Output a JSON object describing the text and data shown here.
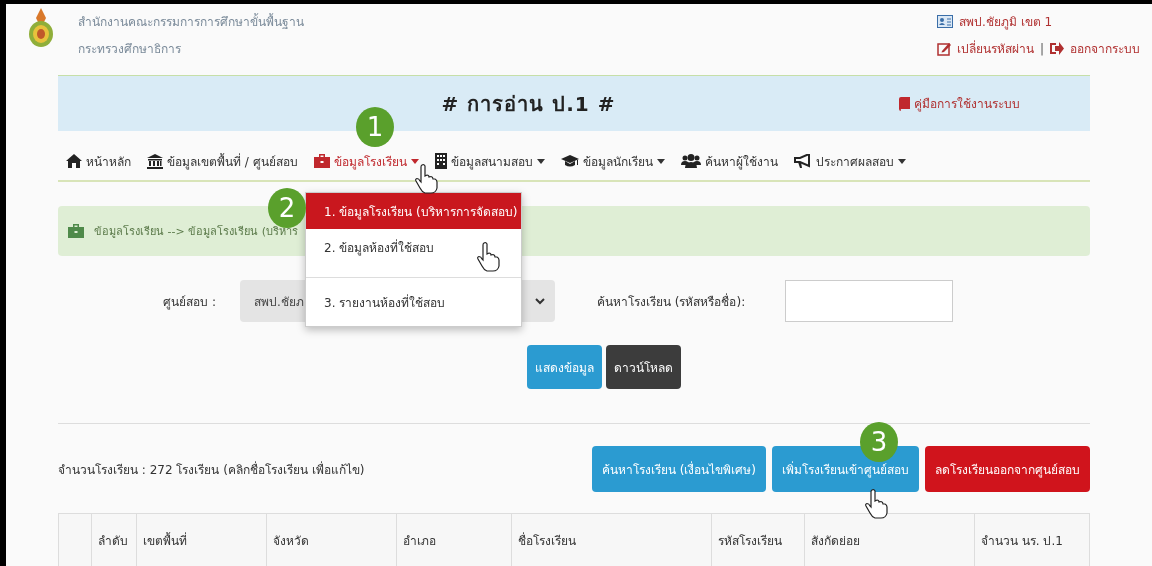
{
  "header": {
    "org_lines": [
      "สำนักงานคณะกรรมการการศึกษาขั้นพื้นฐาน",
      "กระทรวงศึกษาธิการ"
    ],
    "user": "สพป.ชัยภูมิ เขต 1",
    "change_password": "เปลี่ยนรหัสผ่าน",
    "separator": "|",
    "logout": "ออกจากระบบ"
  },
  "banner": {
    "title": "# การอ่าน ป.1 #",
    "manual_link": "คู่มือการใช้งานระบบ"
  },
  "nav": [
    {
      "label": "หน้าหลัก",
      "dropdown": false,
      "selected": false
    },
    {
      "label": "ข้อมูลเขตพื้นที่ / ศูนย์สอบ",
      "dropdown": false,
      "selected": false
    },
    {
      "label": "ข้อมูลโรงเรียน",
      "dropdown": true,
      "selected": true
    },
    {
      "label": "ข้อมูลสนามสอบ",
      "dropdown": true,
      "selected": false
    },
    {
      "label": "ข้อมูลนักเรียน",
      "dropdown": true,
      "selected": false
    },
    {
      "label": "ค้นหาผู้ใช้งาน",
      "dropdown": false,
      "selected": false
    },
    {
      "label": "ประกาศผลสอบ",
      "dropdown": true,
      "selected": false
    }
  ],
  "dropdown_menu": [
    {
      "label": "1. ข้อมูลโรงเรียน (บริหารการจัดสอบ)",
      "selected": true,
      "divider_before": false
    },
    {
      "label": "2. ข้อมูลห้องที่ใช้สอบ",
      "selected": false,
      "divider_before": false
    },
    {
      "label": "3. รายงานห้องที่ใช้สอบ",
      "selected": false,
      "divider_before": true
    }
  ],
  "breadcrumb": "ข้อมูลโรงเรียน --> ข้อมูลโรงเรียน (บริหาร",
  "filters": {
    "center_label": "ศูนย์สอบ :",
    "center_value": "สพป.ชัยภ",
    "search_label": "ค้นหาโรงเรียน (รหัสหรือชื่อ):"
  },
  "filter_buttons": [
    {
      "label": "แสดงข้อมูล",
      "kind": "primary"
    },
    {
      "label": "ดาวน์โหลด",
      "kind": "dark"
    }
  ],
  "school_count": "จำนวนโรงเรียน : 272 โรงเรียน (คลิกชื่อโรงเรียน เพื่อแก้ไข)",
  "action_buttons": [
    {
      "label": "ค้นหาโรงเรียน (เงื่อนไขพิเศษ)",
      "kind": "primary"
    },
    {
      "label": "เพิ่มโรงเรียนเข้าศูนย์สอบ",
      "kind": "primary"
    },
    {
      "label": "ลดโรงเรียนออกจากศูนย์สอบ",
      "kind": "danger"
    }
  ],
  "table": {
    "columns": [
      "ลำดับ",
      "เขตพื้นที่",
      "จังหวัด",
      "อำเภอ",
      "ชื่อโรงเรียน",
      "รหัสโรงเรียน",
      "สังกัดย่อย",
      "จำนวน นร. ป.1"
    ]
  },
  "step_markers": [
    "1",
    "2",
    "3"
  ]
}
